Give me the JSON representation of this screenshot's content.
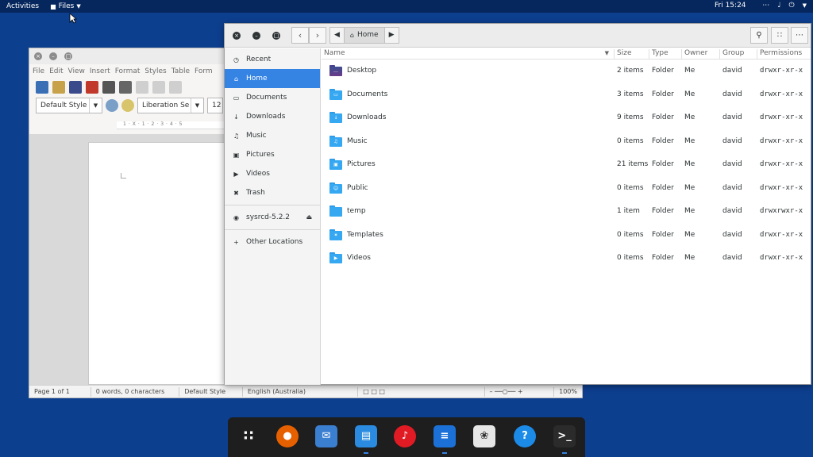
{
  "topbar": {
    "activities": "Activities",
    "app_menu": "Files",
    "clock": "Fri 15:24"
  },
  "writer": {
    "menus": [
      "File",
      "Edit",
      "View",
      "Insert",
      "Format",
      "Styles",
      "Table",
      "Form"
    ],
    "paragraph_style": "Default Style",
    "font_name": "Liberation Se",
    "font_size": "12",
    "status": {
      "page": "Page 1 of 1",
      "words": "0 words, 0 characters",
      "style": "Default Style",
      "language": "English (Australia)",
      "zoom": "100%"
    }
  },
  "files": {
    "path": "Home",
    "sidebar": [
      {
        "label": "Recent",
        "icon": "clock-icon"
      },
      {
        "label": "Home",
        "icon": "home-icon",
        "active": true
      },
      {
        "label": "Documents",
        "icon": "document-icon"
      },
      {
        "label": "Downloads",
        "icon": "download-icon"
      },
      {
        "label": "Music",
        "icon": "music-icon"
      },
      {
        "label": "Pictures",
        "icon": "picture-icon"
      },
      {
        "label": "Videos",
        "icon": "video-icon"
      },
      {
        "label": "Trash",
        "icon": "trash-icon"
      }
    ],
    "device": "sysrcd-5.2.2",
    "other_locations": "Other Locations",
    "columns": [
      "Name",
      "Size",
      "Type",
      "Owner",
      "Group",
      "Permissions"
    ],
    "rows": [
      {
        "name": "Desktop",
        "size": "2 items",
        "type": "Folder",
        "owner": "Me",
        "group": "david",
        "perm": "drwxr-xr-x"
      },
      {
        "name": "Documents",
        "size": "3 items",
        "type": "Folder",
        "owner": "Me",
        "group": "david",
        "perm": "drwxr-xr-x"
      },
      {
        "name": "Downloads",
        "size": "9 items",
        "type": "Folder",
        "owner": "Me",
        "group": "david",
        "perm": "drwxr-xr-x"
      },
      {
        "name": "Music",
        "size": "0 items",
        "type": "Folder",
        "owner": "Me",
        "group": "david",
        "perm": "drwxr-xr-x"
      },
      {
        "name": "Pictures",
        "size": "21 items",
        "type": "Folder",
        "owner": "Me",
        "group": "david",
        "perm": "drwxr-xr-x"
      },
      {
        "name": "Public",
        "size": "0 items",
        "type": "Folder",
        "owner": "Me",
        "group": "david",
        "perm": "drwxr-xr-x"
      },
      {
        "name": "temp",
        "size": "1 item",
        "type": "Folder",
        "owner": "Me",
        "group": "david",
        "perm": "drwxrwxr-x"
      },
      {
        "name": "Templates",
        "size": "0 items",
        "type": "Folder",
        "owner": "Me",
        "group": "david",
        "perm": "drwxr-xr-x"
      },
      {
        "name": "Videos",
        "size": "0 items",
        "type": "Folder",
        "owner": "Me",
        "group": "david",
        "perm": "drwxr-xr-x"
      }
    ]
  },
  "dock": [
    {
      "name": "app-grid-icon",
      "color": "#1e1e1e"
    },
    {
      "name": "firefox-icon",
      "color": "#e66000"
    },
    {
      "name": "mail-icon",
      "color": "#3b7fd1"
    },
    {
      "name": "file-manager-icon",
      "color": "#2a8be0"
    },
    {
      "name": "music-player-icon",
      "color": "#e01b24"
    },
    {
      "name": "writer-icon",
      "color": "#1c71d8"
    },
    {
      "name": "gimp-icon",
      "color": "#e6e6e6"
    },
    {
      "name": "help-icon",
      "color": "#1c8be8"
    },
    {
      "name": "terminal-icon",
      "color": "#2b2b2b"
    }
  ],
  "colors": {
    "desktop": "#0d3f8f",
    "accent": "#3584e4",
    "folder": "#36a8f2"
  }
}
